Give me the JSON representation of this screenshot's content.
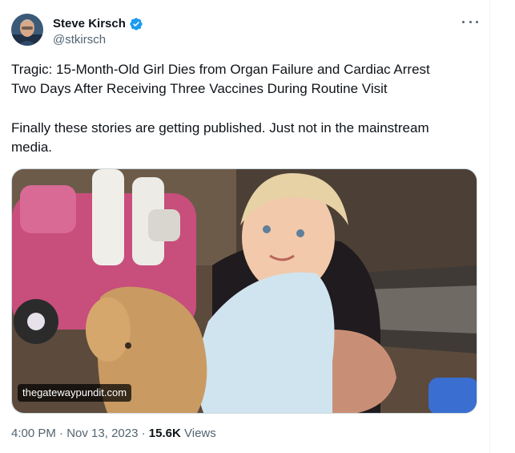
{
  "author": {
    "name": "Steve Kirsch",
    "handle": "@stkirsch",
    "verified": true,
    "verified_color": "#1d9bf0"
  },
  "tweet": {
    "headline_line1": "Tragic: 15-Month-Old Girl Dies from Organ Failure and Cardiac Arrest",
    "headline_line2": "Two Days After Receiving Three Vaccines During Routine Visit",
    "comment_line1": "Finally these stories are getting published. Just not in the mainstream",
    "comment_line2": "media."
  },
  "media": {
    "source_label": "thegatewaypundit.com",
    "icon": "photo"
  },
  "meta": {
    "time": "4:00 PM",
    "separator": "·",
    "date": "Nov 13, 2023",
    "views_count": "15.6K",
    "views_label": "Views"
  },
  "icons": {
    "more": "more-horizontal-icon",
    "verified": "verified-badge-icon"
  }
}
